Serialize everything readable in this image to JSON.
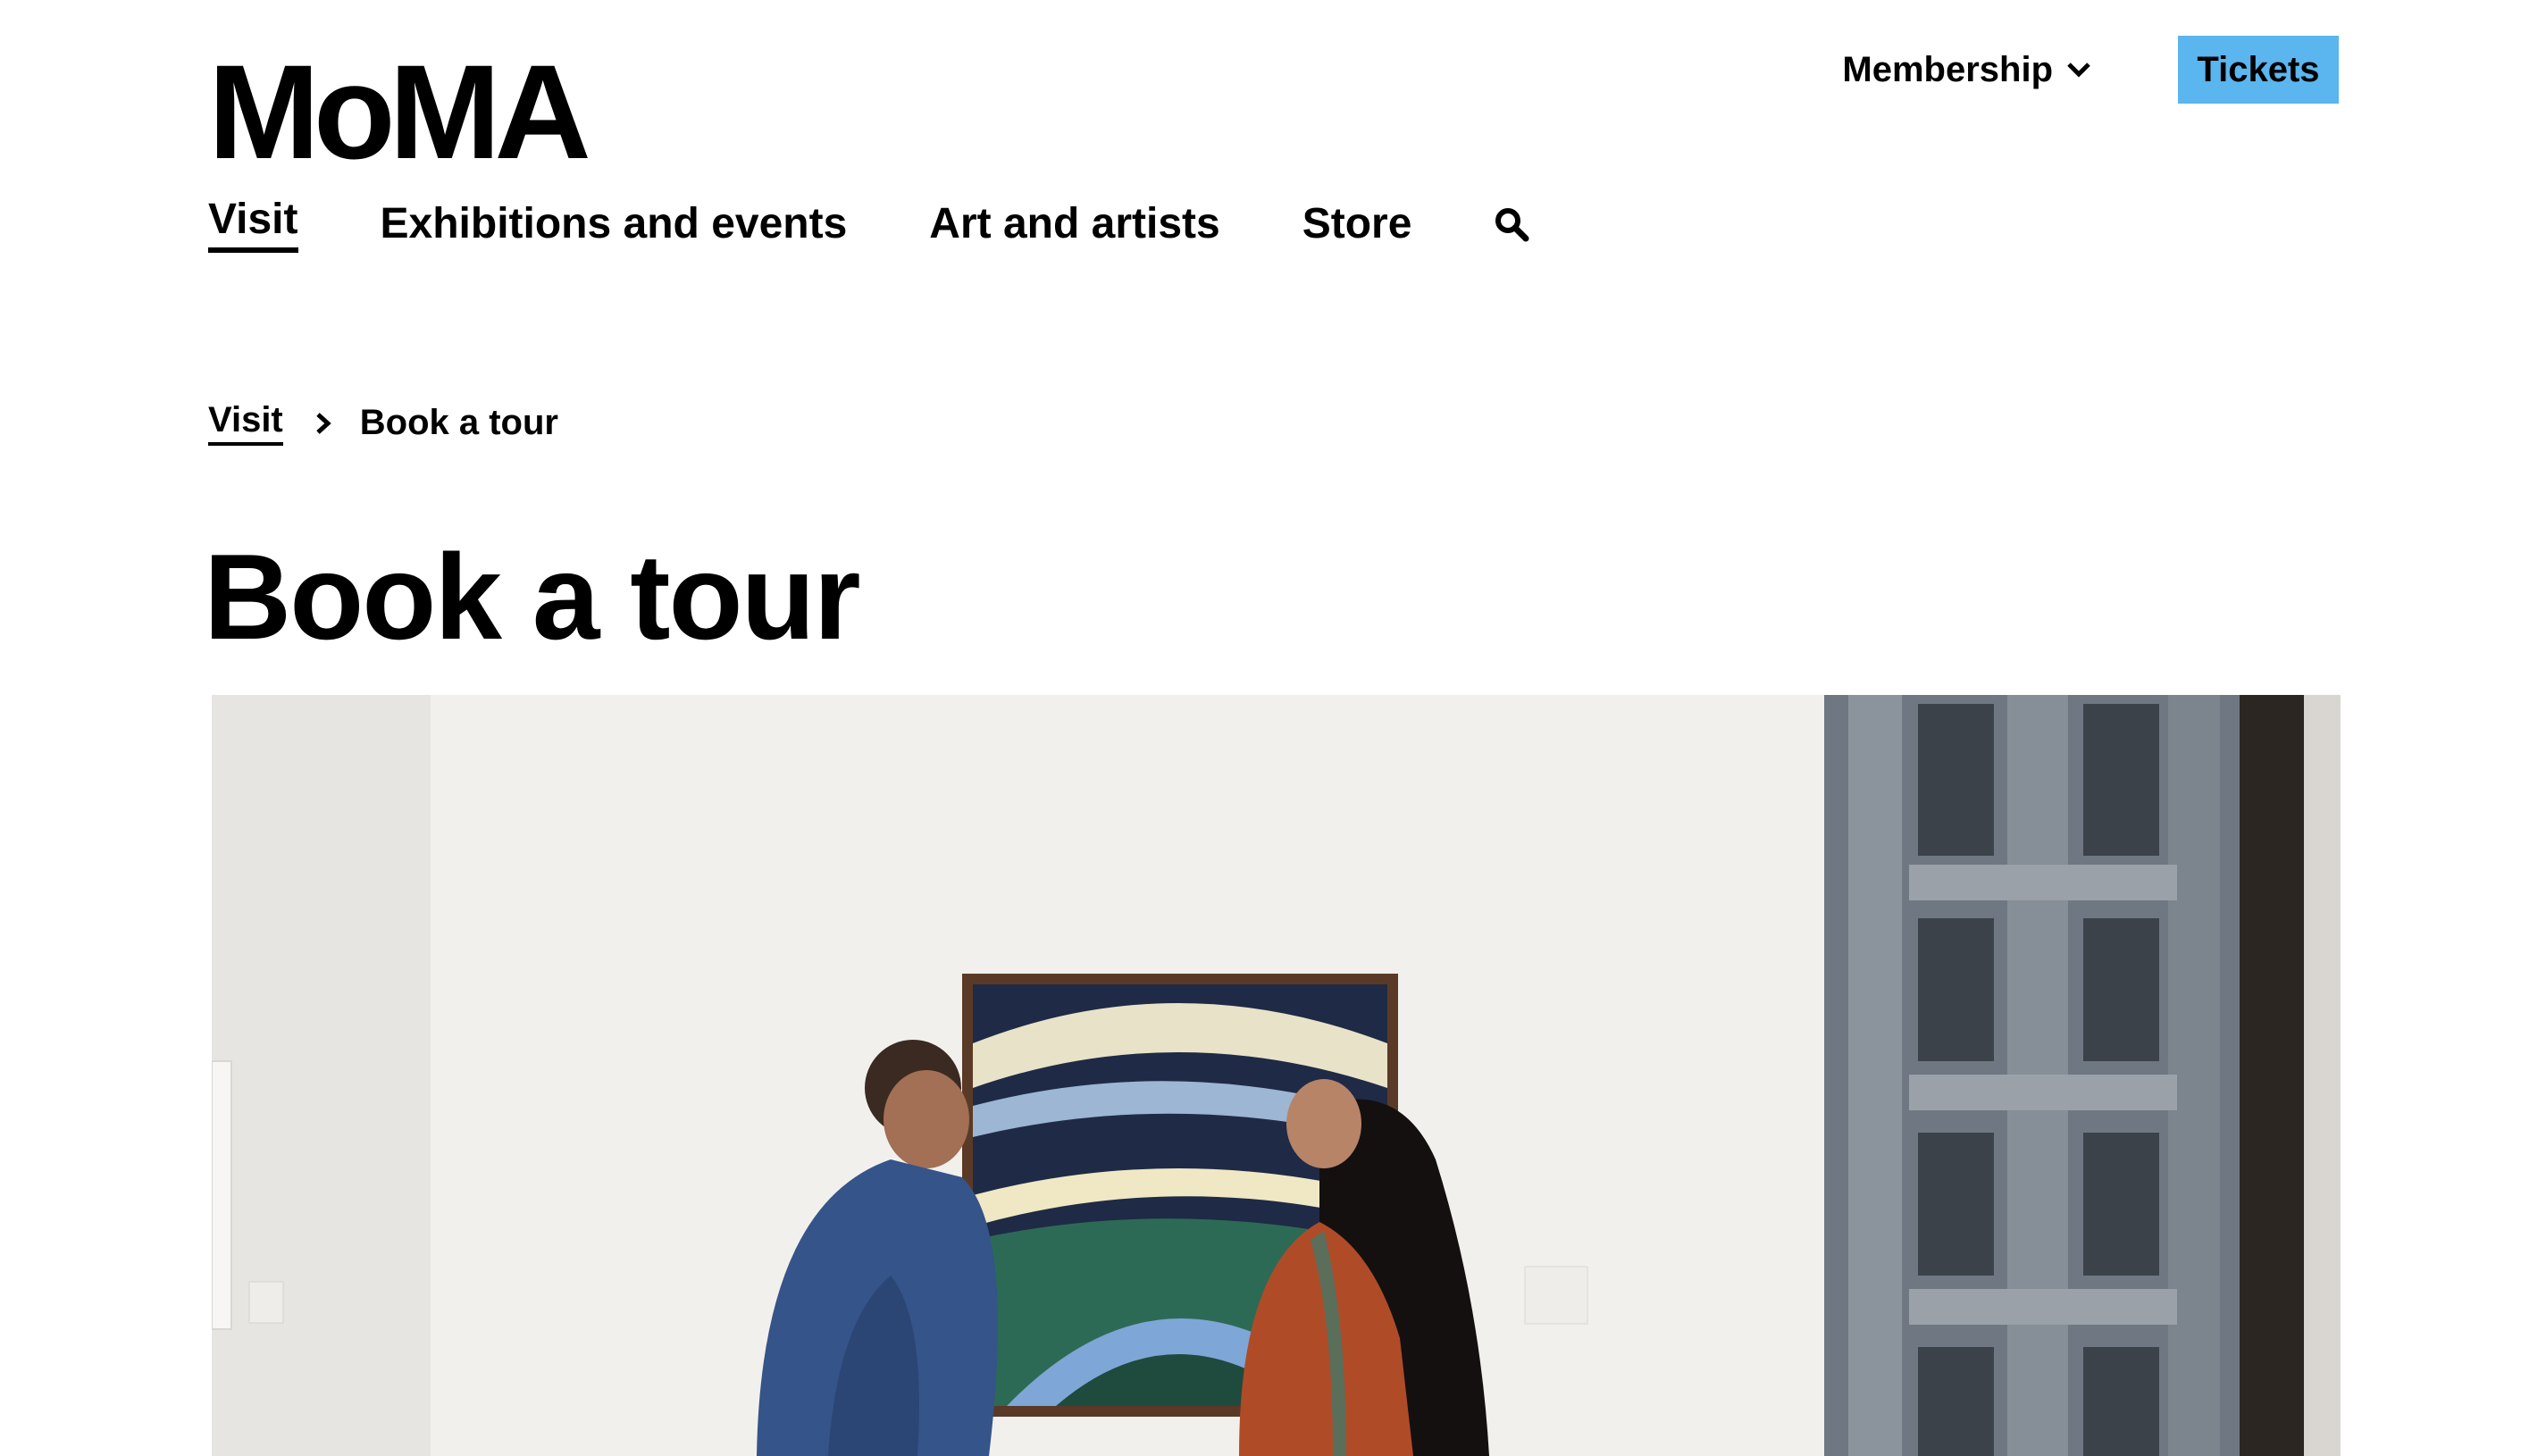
{
  "header": {
    "logo": "MoMA",
    "membership_label": "Membership",
    "tickets_label": "Tickets"
  },
  "nav": {
    "items": [
      {
        "label": "Visit",
        "active": true
      },
      {
        "label": "Exhibitions and events",
        "active": false
      },
      {
        "label": "Art and artists",
        "active": false
      },
      {
        "label": "Store",
        "active": false
      }
    ]
  },
  "breadcrumb": {
    "items": [
      {
        "label": "Visit"
      },
      {
        "label": "Book a tour"
      }
    ]
  },
  "page": {
    "title": "Book a tour"
  },
  "hero": {
    "description": ""
  },
  "colors": {
    "accent": "#5bb5ee",
    "text": "#000000",
    "background": "#ffffff"
  },
  "icons": [
    "chevron-down-icon",
    "search-icon",
    "chevron-right-icon"
  ]
}
